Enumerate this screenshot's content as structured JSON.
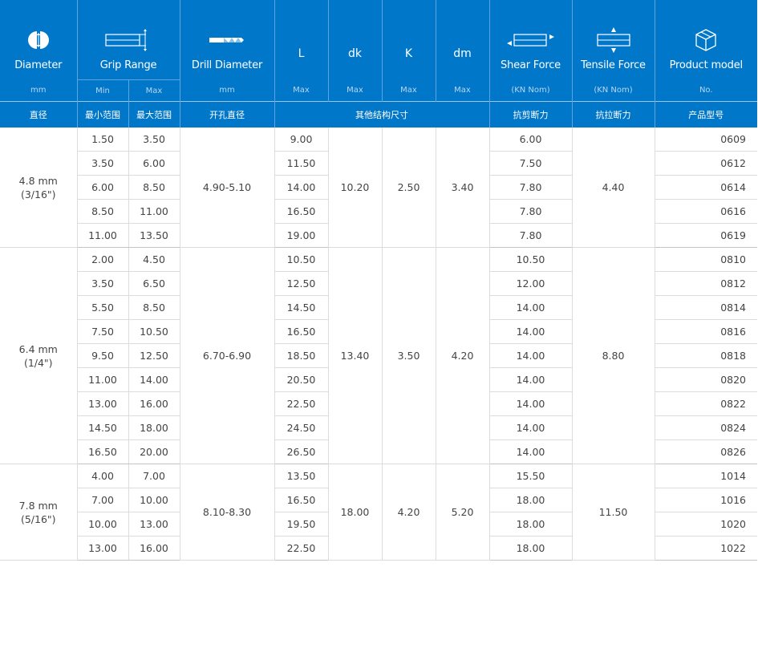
{
  "header": {
    "diameter": {
      "title": "Diameter",
      "unit": "mm",
      "cn": "直径"
    },
    "grip": {
      "title": "Grip Range",
      "min": "Min",
      "max": "Max",
      "cn_min": "最小范围",
      "cn_max": "最大范围"
    },
    "drill": {
      "title": "Drill Diameter",
      "unit": "mm",
      "cn": "开孔直径"
    },
    "L": {
      "title": "L",
      "unit": "Max"
    },
    "dk": {
      "title": "dk",
      "unit": "Max"
    },
    "K": {
      "title": "K",
      "unit": "Max"
    },
    "dm": {
      "title": "dm",
      "unit": "Max"
    },
    "other_cn": "其他结构尺寸",
    "shear": {
      "title": "Shear Force",
      "unit": "(KN Nom)",
      "cn": "抗剪断力"
    },
    "tensile": {
      "title": "Tensile Force",
      "unit": "(KN Nom)",
      "cn": "抗拉断力"
    },
    "model": {
      "title": "Product model",
      "unit": "No.",
      "cn": "产品型号"
    }
  },
  "groups": [
    {
      "diameter": "4.8 mm",
      "diameter_inch": "(3/16\")",
      "drill": "4.90-5.10",
      "dk": "10.20",
      "k": "2.50",
      "dm": "3.40",
      "tensile": "4.40",
      "rows": [
        {
          "min": "1.50",
          "max": "3.50",
          "L": "9.00",
          "shear": "6.00",
          "model": "0609"
        },
        {
          "min": "3.50",
          "max": "6.00",
          "L": "11.50",
          "shear": "7.50",
          "model": "0612"
        },
        {
          "min": "6.00",
          "max": "8.50",
          "L": "14.00",
          "shear": "7.80",
          "model": "0614"
        },
        {
          "min": "8.50",
          "max": "11.00",
          "L": "16.50",
          "shear": "7.80",
          "model": "0616"
        },
        {
          "min": "11.00",
          "max": "13.50",
          "L": "19.00",
          "shear": "7.80",
          "model": "0619"
        }
      ]
    },
    {
      "diameter": "6.4 mm",
      "diameter_inch": "(1/4\")",
      "drill": "6.70-6.90",
      "dk": "13.40",
      "k": "3.50",
      "dm": "4.20",
      "tensile": "8.80",
      "rows": [
        {
          "min": "2.00",
          "max": "4.50",
          "L": "10.50",
          "shear": "10.50",
          "model": "0810"
        },
        {
          "min": "3.50",
          "max": "6.50",
          "L": "12.50",
          "shear": "12.00",
          "model": "0812"
        },
        {
          "min": "5.50",
          "max": "8.50",
          "L": "14.50",
          "shear": "14.00",
          "model": "0814"
        },
        {
          "min": "7.50",
          "max": "10.50",
          "L": "16.50",
          "shear": "14.00",
          "model": "0816"
        },
        {
          "min": "9.50",
          "max": "12.50",
          "L": "18.50",
          "shear": "14.00",
          "model": "0818"
        },
        {
          "min": "11.00",
          "max": "14.00",
          "L": "20.50",
          "shear": "14.00",
          "model": "0820"
        },
        {
          "min": "13.00",
          "max": "16.00",
          "L": "22.50",
          "shear": "14.00",
          "model": "0822"
        },
        {
          "min": "14.50",
          "max": "18.00",
          "L": "24.50",
          "shear": "14.00",
          "model": "0824"
        },
        {
          "min": "16.50",
          "max": "20.00",
          "L": "26.50",
          "shear": "14.00",
          "model": "0826"
        }
      ]
    },
    {
      "diameter": "7.8 mm",
      "diameter_inch": "(5/16\")",
      "drill": "8.10-8.30",
      "dk": "18.00",
      "k": "4.20",
      "dm": "5.20",
      "tensile": "11.50",
      "rows": [
        {
          "min": "4.00",
          "max": "7.00",
          "L": "13.50",
          "shear": "15.50",
          "model": "1014"
        },
        {
          "min": "7.00",
          "max": "10.00",
          "L": "16.50",
          "shear": "18.00",
          "model": "1016"
        },
        {
          "min": "10.00",
          "max": "13.00",
          "L": "19.50",
          "shear": "18.00",
          "model": "1020"
        },
        {
          "min": "13.00",
          "max": "16.00",
          "L": "22.50",
          "shear": "18.00",
          "model": "1022"
        }
      ]
    }
  ],
  "colors": {
    "header_bg": "#0077c8",
    "header_text": "#ffffff",
    "body_text": "#444444",
    "grid": "#dcdcdc"
  },
  "icons": [
    "diameter-icon",
    "grip-range-icon",
    "drill-bit-icon",
    "shear-force-icon",
    "tensile-force-icon",
    "product-box-icon"
  ]
}
